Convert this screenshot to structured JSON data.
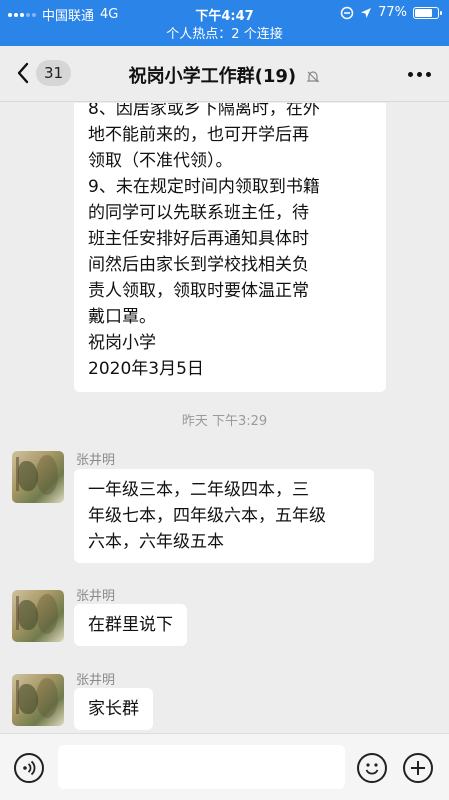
{
  "status_bar": {
    "carrier": "中国联通",
    "network": "4G",
    "time": "下午4:47",
    "battery": "77%",
    "battery_level": 0.77
  },
  "hotspot_banner": "个人热点：2 个连接",
  "nav": {
    "back_badge": "31",
    "title": "祝岗小学工作群(19)"
  },
  "messages": {
    "first": {
      "text": "8、因居家或乡下隔离时，在外\n地不能前来的，也可开学后再\n领取（不准代领）。\n9、未在规定时间内领取到书籍\n的同学可以先联系班主任，待\n班主任安排好后再通知具体时\n间然后由家长到学校找相关负\n责人领取，领取时要体温正常\n戴口罩。\n祝岗小学\n2020年3月5日"
    },
    "timestamp": "昨天 下午3:29",
    "items": [
      {
        "sender": "张井明",
        "text": "一年级三本，二年级四本，三\n年级七本，四年级六本，五年级\n六本，六年级五本"
      },
      {
        "sender": "张井明",
        "text": "在群里说下"
      },
      {
        "sender": "张井明",
        "text": "家长群"
      }
    ]
  },
  "input_bar": {
    "icons": [
      "voice-icon",
      "emoji-icon",
      "plus-icon"
    ]
  }
}
